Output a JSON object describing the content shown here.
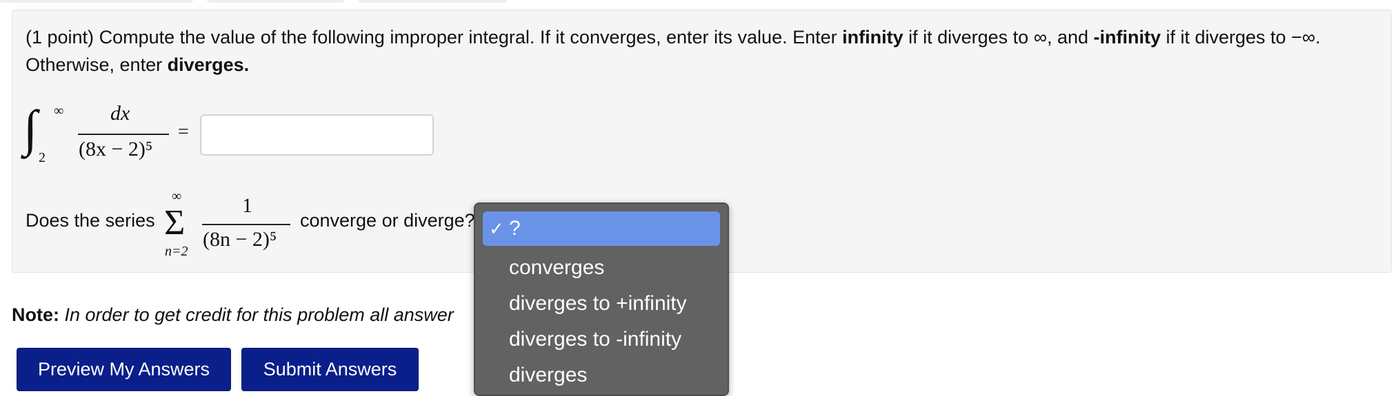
{
  "problem": {
    "points": "(1 point)",
    "text_part1": " Compute the value of the following improper integral. If it converges, enter its value. Enter ",
    "infinity_bold": "infinity",
    "text_part2": " if it diverges to ∞, and ",
    "neg_infinity_bold": "-infinity",
    "text_part3": " if it diverges to −∞. Otherwise, enter ",
    "diverges_bold": "diverges."
  },
  "integral": {
    "sign": "∫",
    "upper": "∞",
    "lower": "2",
    "numerator": "dx",
    "denominator": "(8x − 2)⁵",
    "equals": "=",
    "answer_value": ""
  },
  "series": {
    "label": "Does the series",
    "sum_top": "∞",
    "sum_sign": "Σ",
    "sum_bottom": "n=2",
    "numerator": "1",
    "denominator": "(8n − 2)⁵",
    "question": "converge or diverge?"
  },
  "note": {
    "label": "Note:",
    "text": "In order to get credit for this problem all answer"
  },
  "buttons": {
    "preview": "Preview My Answers",
    "submit": "Submit Answers"
  },
  "dropdown": {
    "selected": "?",
    "check": "✓",
    "options": [
      "converges",
      "diverges to +infinity",
      "diverges to -infinity",
      "diverges"
    ]
  },
  "colors": {
    "button_bg": "#0a1f8a",
    "dropdown_bg": "#626262",
    "dropdown_highlight": "#6a93e8",
    "problem_bg": "#f5f5f5"
  }
}
